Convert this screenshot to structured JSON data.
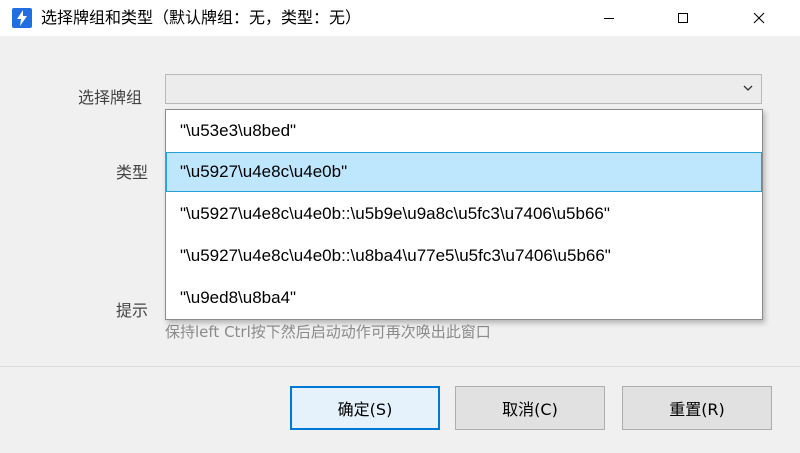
{
  "window": {
    "title": "选择牌组和类型（默认牌组：无，类型：无）",
    "icon": "lightning-bolt-icon",
    "accent": "#0078d7"
  },
  "form": {
    "deck_label": "选择牌组",
    "type_label": "类型",
    "hint_label": "提示",
    "hint_text": "保持left Ctrl按下然后启动动作可再次唤出此窗口",
    "deck_value": ""
  },
  "dropdown": {
    "items": [
      "\"\\u53e3\\u8bed\"",
      "\"\\u5927\\u4e8c\\u4e0b\"",
      "\"\\u5927\\u4e8c\\u4e0b::\\u5b9e\\u9a8c\\u5fc3\\u7406\\u5b66\"",
      "\"\\u5927\\u4e8c\\u4e0b::\\u8ba4\\u77e5\\u5fc3\\u7406\\u5b66\"",
      "\"\\u9ed8\\u8ba4\""
    ],
    "selected_index": 1
  },
  "buttons": {
    "ok": "确定(S)",
    "cancel": "取消(C)",
    "reset": "重置(R)"
  }
}
